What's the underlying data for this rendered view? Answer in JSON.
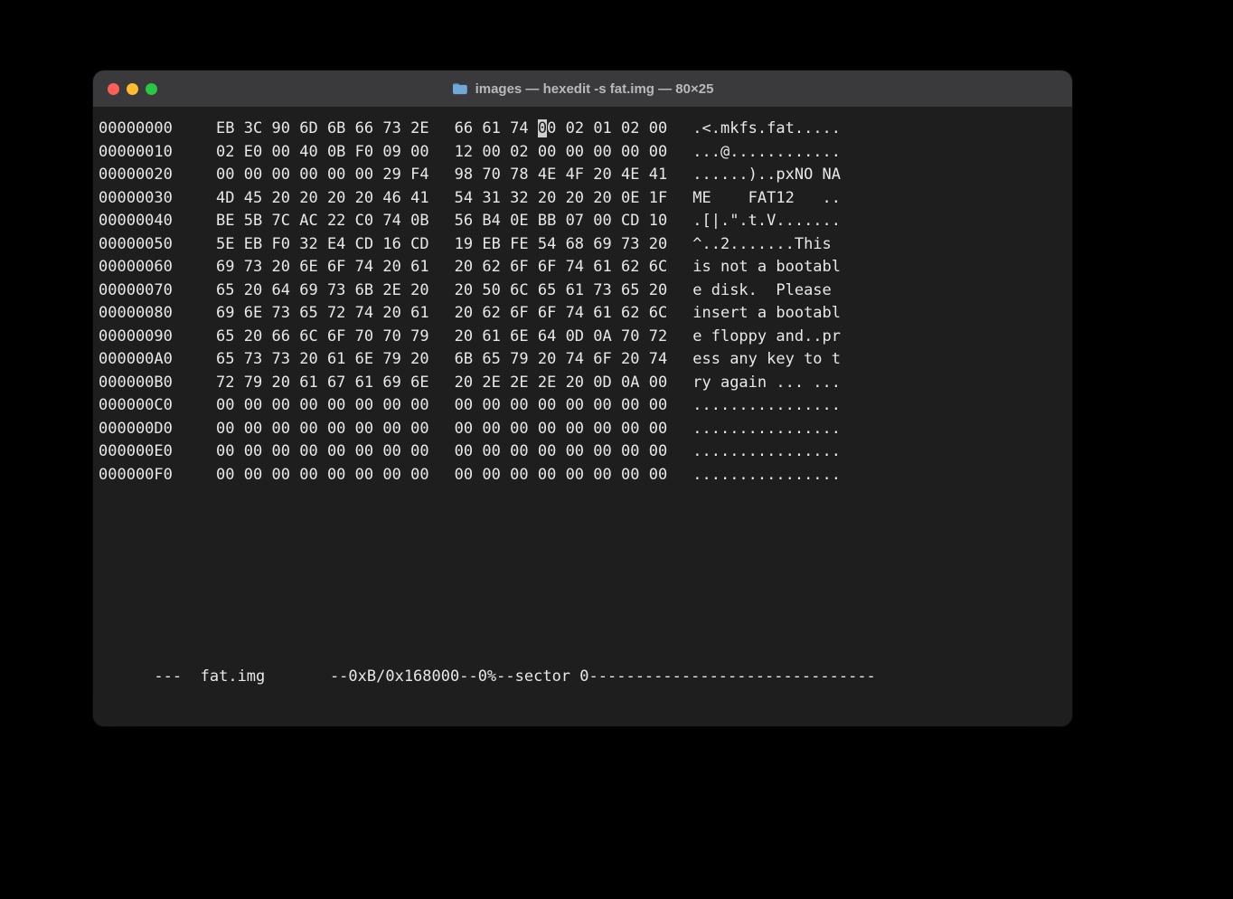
{
  "window": {
    "title": "images — hexedit -s fat.img — 80×25"
  },
  "cursor": {
    "row": 0,
    "col": 11
  },
  "rows": [
    {
      "offset": "00000000",
      "hex": [
        "EB",
        "3C",
        "90",
        "6D",
        "6B",
        "66",
        "73",
        "2E",
        "66",
        "61",
        "74",
        "00",
        "02",
        "01",
        "02",
        "00"
      ],
      "ascii": ".<.mkfs.fat....."
    },
    {
      "offset": "00000010",
      "hex": [
        "02",
        "E0",
        "00",
        "40",
        "0B",
        "F0",
        "09",
        "00",
        "12",
        "00",
        "02",
        "00",
        "00",
        "00",
        "00",
        "00"
      ],
      "ascii": "...@............"
    },
    {
      "offset": "00000020",
      "hex": [
        "00",
        "00",
        "00",
        "00",
        "00",
        "00",
        "29",
        "F4",
        "98",
        "70",
        "78",
        "4E",
        "4F",
        "20",
        "4E",
        "41"
      ],
      "ascii": "......)..pxNO NA"
    },
    {
      "offset": "00000030",
      "hex": [
        "4D",
        "45",
        "20",
        "20",
        "20",
        "20",
        "46",
        "41",
        "54",
        "31",
        "32",
        "20",
        "20",
        "20",
        "0E",
        "1F"
      ],
      "ascii": "ME    FAT12   .."
    },
    {
      "offset": "00000040",
      "hex": [
        "BE",
        "5B",
        "7C",
        "AC",
        "22",
        "C0",
        "74",
        "0B",
        "56",
        "B4",
        "0E",
        "BB",
        "07",
        "00",
        "CD",
        "10"
      ],
      "ascii": ".[|.\".t.V......."
    },
    {
      "offset": "00000050",
      "hex": [
        "5E",
        "EB",
        "F0",
        "32",
        "E4",
        "CD",
        "16",
        "CD",
        "19",
        "EB",
        "FE",
        "54",
        "68",
        "69",
        "73",
        "20"
      ],
      "ascii": "^..2.......This "
    },
    {
      "offset": "00000060",
      "hex": [
        "69",
        "73",
        "20",
        "6E",
        "6F",
        "74",
        "20",
        "61",
        "20",
        "62",
        "6F",
        "6F",
        "74",
        "61",
        "62",
        "6C"
      ],
      "ascii": "is not a bootabl"
    },
    {
      "offset": "00000070",
      "hex": [
        "65",
        "20",
        "64",
        "69",
        "73",
        "6B",
        "2E",
        "20",
        "20",
        "50",
        "6C",
        "65",
        "61",
        "73",
        "65",
        "20"
      ],
      "ascii": "e disk.  Please "
    },
    {
      "offset": "00000080",
      "hex": [
        "69",
        "6E",
        "73",
        "65",
        "72",
        "74",
        "20",
        "61",
        "20",
        "62",
        "6F",
        "6F",
        "74",
        "61",
        "62",
        "6C"
      ],
      "ascii": "insert a bootabl"
    },
    {
      "offset": "00000090",
      "hex": [
        "65",
        "20",
        "66",
        "6C",
        "6F",
        "70",
        "70",
        "79",
        "20",
        "61",
        "6E",
        "64",
        "0D",
        "0A",
        "70",
        "72"
      ],
      "ascii": "e floppy and..pr"
    },
    {
      "offset": "000000A0",
      "hex": [
        "65",
        "73",
        "73",
        "20",
        "61",
        "6E",
        "79",
        "20",
        "6B",
        "65",
        "79",
        "20",
        "74",
        "6F",
        "20",
        "74"
      ],
      "ascii": "ess any key to t"
    },
    {
      "offset": "000000B0",
      "hex": [
        "72",
        "79",
        "20",
        "61",
        "67",
        "61",
        "69",
        "6E",
        "20",
        "2E",
        "2E",
        "2E",
        "20",
        "0D",
        "0A",
        "00"
      ],
      "ascii": "ry again ... ..."
    },
    {
      "offset": "000000C0",
      "hex": [
        "00",
        "00",
        "00",
        "00",
        "00",
        "00",
        "00",
        "00",
        "00",
        "00",
        "00",
        "00",
        "00",
        "00",
        "00",
        "00"
      ],
      "ascii": "................"
    },
    {
      "offset": "000000D0",
      "hex": [
        "00",
        "00",
        "00",
        "00",
        "00",
        "00",
        "00",
        "00",
        "00",
        "00",
        "00",
        "00",
        "00",
        "00",
        "00",
        "00"
      ],
      "ascii": "................"
    },
    {
      "offset": "000000E0",
      "hex": [
        "00",
        "00",
        "00",
        "00",
        "00",
        "00",
        "00",
        "00",
        "00",
        "00",
        "00",
        "00",
        "00",
        "00",
        "00",
        "00"
      ],
      "ascii": "................"
    },
    {
      "offset": "000000F0",
      "hex": [
        "00",
        "00",
        "00",
        "00",
        "00",
        "00",
        "00",
        "00",
        "00",
        "00",
        "00",
        "00",
        "00",
        "00",
        "00",
        "00"
      ],
      "ascii": "................"
    }
  ],
  "status": {
    "mode": "---",
    "filename": "fat.img",
    "pos": "--0xB/0x168000--0%--sector 0",
    "tail": "-------------------------------"
  }
}
